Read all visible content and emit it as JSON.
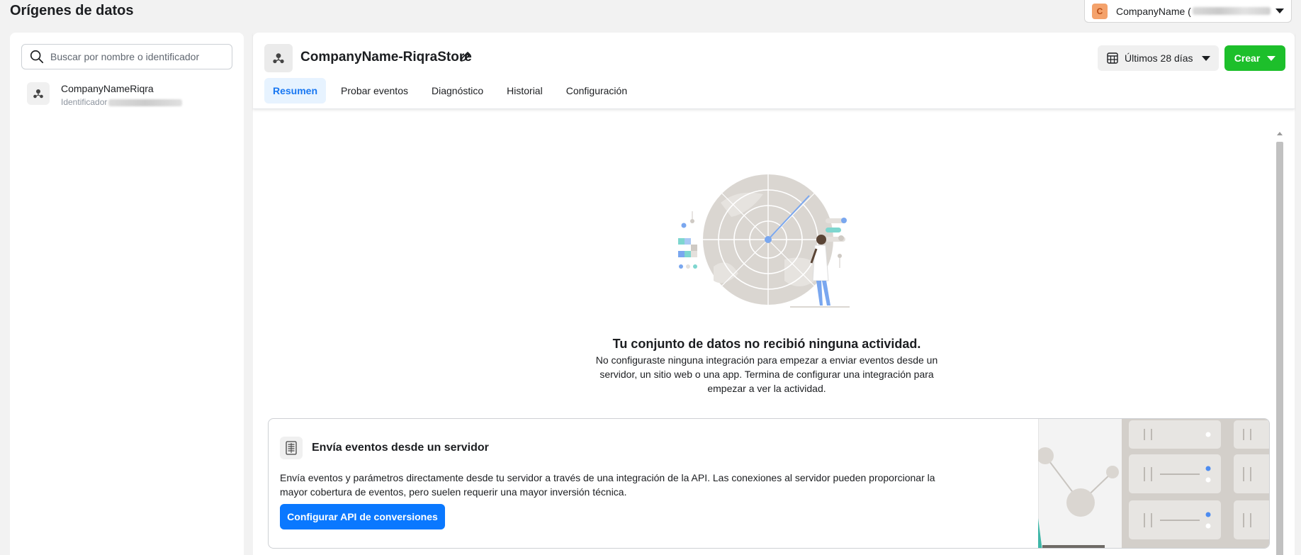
{
  "page": {
    "title": "Orígenes de datos"
  },
  "account": {
    "avatar_letter": "C",
    "name": "CompanyName ("
  },
  "sidebar": {
    "search_placeholder": "Buscar por nombre o identificador",
    "items": [
      {
        "name": "CompanyNameRiqra",
        "id_label": "Identificador"
      }
    ]
  },
  "dataset": {
    "title": "CompanyName-RiqraStore",
    "date_range": "Últimos 28 días",
    "create_label": "Crear",
    "tabs": [
      {
        "label": "Resumen",
        "active": true
      },
      {
        "label": "Probar eventos"
      },
      {
        "label": "Diagnóstico"
      },
      {
        "label": "Historial"
      },
      {
        "label": "Configuración"
      }
    ]
  },
  "empty_state": {
    "title": "Tu conjunto de datos no recibió ninguna actividad.",
    "description": "No configuraste ninguna integración para empezar a enviar eventos desde un servidor, un sitio web o una app. Termina de configurar una integración para empezar a ver la actividad."
  },
  "server_card": {
    "title": "Envía eventos desde un servidor",
    "description": "Envía eventos y parámetros directamente desde tu servidor a través de una integración de la API. Las conexiones al servidor pueden proporcionar la mayor cobertura de eventos, pero suelen requerir una mayor inversión técnica.",
    "button_label": "Configurar API de conversiones"
  },
  "colors": {
    "accent_blue": "#1877f2",
    "primary_button": "#0a78ff",
    "create_green": "#1dbf2b",
    "avatar_orange": "#f4a26b"
  }
}
